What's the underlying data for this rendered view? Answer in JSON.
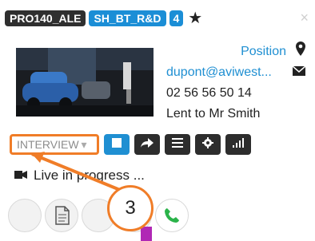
{
  "header": {
    "tags": [
      "PRO140_ALE",
      "SH_BT_R&D",
      "4"
    ],
    "star": "★",
    "close": "×"
  },
  "info": {
    "position_label": "Position",
    "email": "dupont@aviwest...",
    "phone": "02 56 56 50 14",
    "lent": "Lent to Mr Smith"
  },
  "toolbar": {
    "dropdown_value": "INTERVIEW",
    "dropdown_arrow": "▾"
  },
  "status": {
    "live_text": "Live in progress ..."
  },
  "callout": {
    "label": "3"
  },
  "colors": {
    "accent_blue": "#1f8fd2",
    "orange_highlight": "#f07d28",
    "dark_button": "#2d2d2d"
  }
}
